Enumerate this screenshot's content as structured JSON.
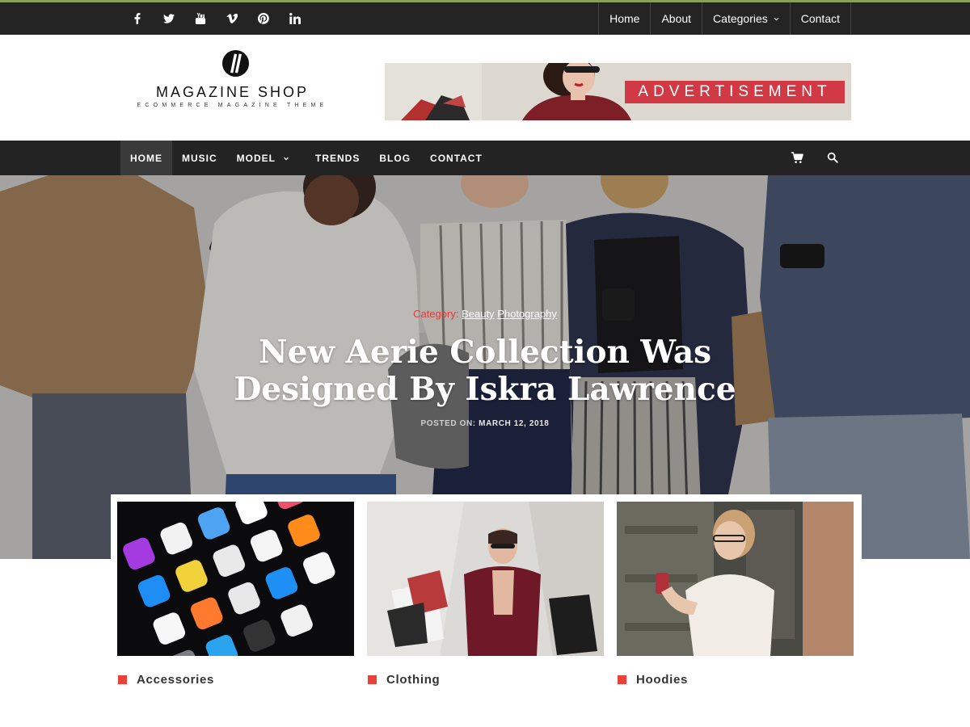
{
  "topbar": {
    "social_icons": [
      "facebook-icon",
      "twitter-icon",
      "youtube-icon",
      "vimeo-icon",
      "pinterest-icon",
      "linkedin-icon"
    ],
    "nav": [
      "Home",
      "About",
      "Categories",
      "Contact"
    ],
    "accent_color": "#8aa05a"
  },
  "header": {
    "logo_title": "MAGAZINE SHOP",
    "logo_tagline": "ECOMMERCE MAGAZINE THEME",
    "ad_label": "ADVERTISEMENT",
    "ad_label_color": "#d13a45"
  },
  "main_nav": {
    "items": [
      "HOME",
      "MUSIC",
      "MODEL",
      "TRENDS",
      "BLOG",
      "CONTACT"
    ],
    "active": "HOME",
    "icons": [
      "cart-icon",
      "search-icon"
    ]
  },
  "hero": {
    "category_label": "Category:",
    "categories": [
      "Beauty",
      "Photography"
    ],
    "title": "New Aerie Collection Was Designed By Iskra Lawrence",
    "posted_label": "POSTED ON:",
    "posted_date": "MARCH 12, 2018"
  },
  "cards": [
    {
      "label": "Accessories"
    },
    {
      "label": "Clothing"
    },
    {
      "label": "Hoodies"
    }
  ],
  "accent_red": "#e8433a"
}
